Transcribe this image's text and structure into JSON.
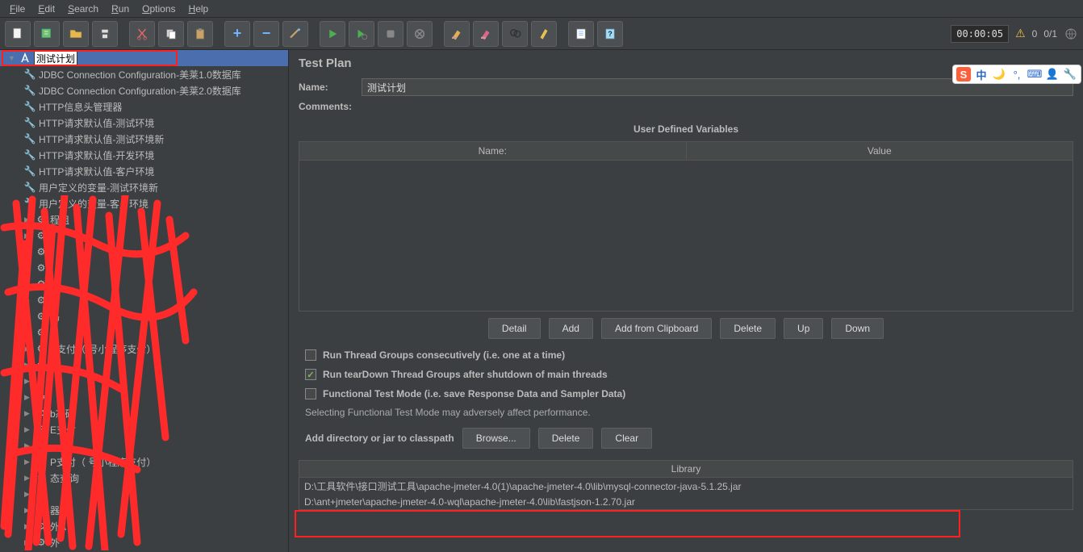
{
  "menu": {
    "file": "File",
    "edit": "Edit",
    "search": "Search",
    "run": "Run",
    "options": "Options",
    "help": "Help"
  },
  "timer": "00:00:05",
  "warn_count": "0",
  "run_count": "0/1",
  "tree": {
    "root": "测试计划",
    "items": [
      "JDBC Connection Configuration-美莱1.0数据库",
      "JDBC Connection Configuration-美莱2.0数据库",
      "HTTP信息头管理器",
      "HTTP请求默认值-测试环境",
      "HTTP请求默认值-测试环境新",
      "HTTP请求默认值-开发环境",
      "HTTP请求默认值-客户环境",
      "用户定义的变量-测试环境新",
      "用户定义的变量-客户环境"
    ],
    "partial": [
      "程组",
      "",
      "",
      "",
      "",
      "",
      "吗",
      "",
      "P支付（      号小程序支付）",
      "吗",
      "",
      "",
      "b态码",
      "E支付",
      "",
      "P支付（      号小程序支付）",
      "态查询",
      "",
      "器",
      "外A",
      "外"
    ]
  },
  "panel": {
    "title": "Test Plan",
    "name_label": "Name:",
    "name_value": "测试计划",
    "comments_label": "Comments:",
    "udv_title": "User Defined Variables",
    "col_name": "Name:",
    "col_value": "Value",
    "btn_detail": "Detail",
    "btn_add": "Add",
    "btn_add_clip": "Add from Clipboard",
    "btn_delete": "Delete",
    "btn_up": "Up",
    "btn_down": "Down",
    "cb_consecutive": "Run Thread Groups consecutively (i.e. one at a time)",
    "cb_teardown": "Run tearDown Thread Groups after shutdown of main threads",
    "cb_functional": "Functional Test Mode (i.e. save Response Data and Sampler Data)",
    "hint": "Selecting Functional Test Mode may adversely affect performance.",
    "classpath_label": "Add directory or jar to classpath",
    "btn_browse": "Browse...",
    "btn_delete2": "Delete",
    "btn_clear": "Clear",
    "lib_header": "Library",
    "lib1": "D:\\工具软件\\接口测试工具\\apache-jmeter-4.0(1)\\apache-jmeter-4.0\\lib\\mysql-connector-java-5.1.25.jar",
    "lib2": "D:\\ant+jmeter\\apache-jmeter-4.0-wql\\apache-jmeter-4.0\\lib\\fastjson-1.2.70.jar"
  },
  "ime": {
    "zhong": "中"
  }
}
